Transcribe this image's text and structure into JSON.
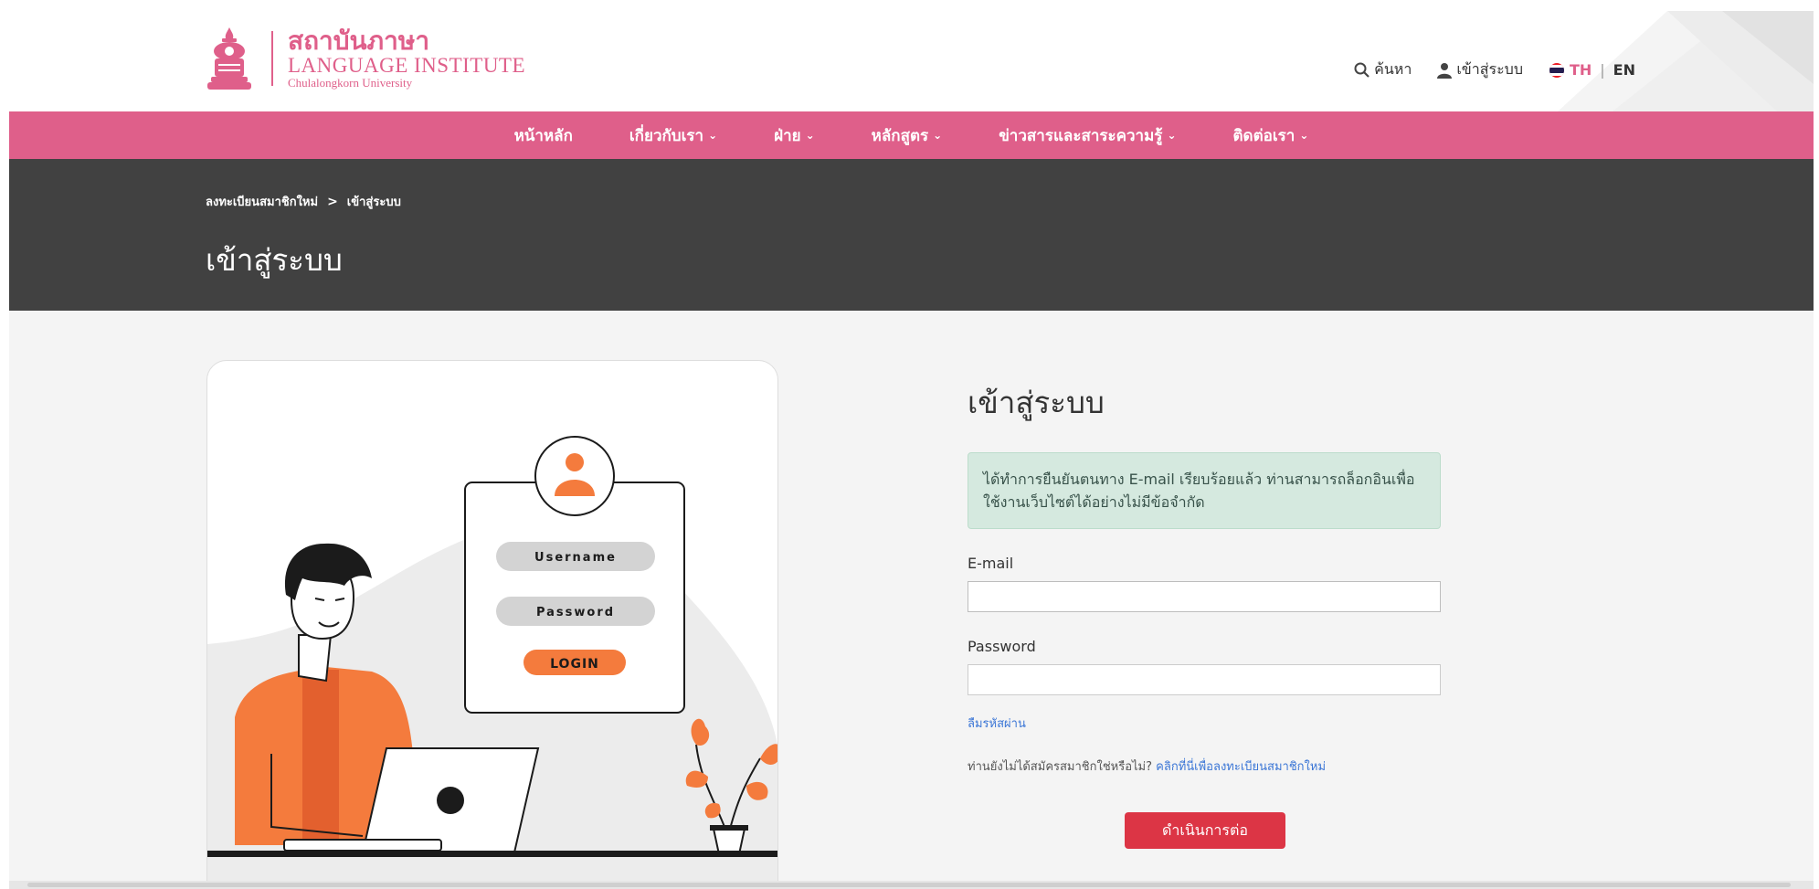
{
  "header": {
    "logo": {
      "thai_name": "สถาบันภาษา",
      "english_name": "LANGUAGE INSTITUTE",
      "university": "Chulalongkorn University"
    },
    "search_label": "ค้นหา",
    "login_label": "เข้าสู่ระบบ",
    "lang_th": "TH",
    "lang_separator": "|",
    "lang_en": "EN"
  },
  "nav": {
    "items": [
      {
        "label": "หน้าหลัก",
        "dropdown": false
      },
      {
        "label": "เกี่ยวกับเรา",
        "dropdown": true
      },
      {
        "label": "ฝ่าย",
        "dropdown": true
      },
      {
        "label": "หลักสูตร",
        "dropdown": true
      },
      {
        "label": "ข่าวสารและสาระความรู้",
        "dropdown": true
      },
      {
        "label": "ติดต่อเรา",
        "dropdown": true
      }
    ]
  },
  "banner": {
    "breadcrumb": [
      "ลงทะเบียนสมาชิกใหม่",
      "เข้าสู่ระบบ"
    ],
    "breadcrumb_separator": ">",
    "title": "เข้าสู่ระบบ"
  },
  "illustration": {
    "username_label": "Username",
    "password_label": "Password",
    "login_label": "LOGIN"
  },
  "form": {
    "title": "เข้าสู่ระบบ",
    "alert": "ได้ทำการยืนยันตนทาง E-mail เรียบร้อยแล้ว ท่านสามารถล็อกอินเพื่อใช้งานเว็บไซต์ได้อย่างไม่มีข้อจำกัด",
    "email_label": "E-mail",
    "email_value": "",
    "password_label": "Password",
    "password_value": "",
    "forgot_label": "ลืมรหัสผ่าน",
    "register_prompt": "ท่านยังไม่ได้สมัครสมาชิกใช่หรือไม่?",
    "register_link": "คลิกที่นี่เพื่อลงทะเบียนสมาชิกใหม่",
    "submit_label": "ดำเนินการต่อ"
  },
  "colors": {
    "brand_pink": "#df5f8a",
    "banner_dark": "#414141",
    "accent_orange": "#f47b3d",
    "submit_red": "#dc3545",
    "alert_green": "#d5e9df",
    "link_blue": "#3b76d6"
  }
}
